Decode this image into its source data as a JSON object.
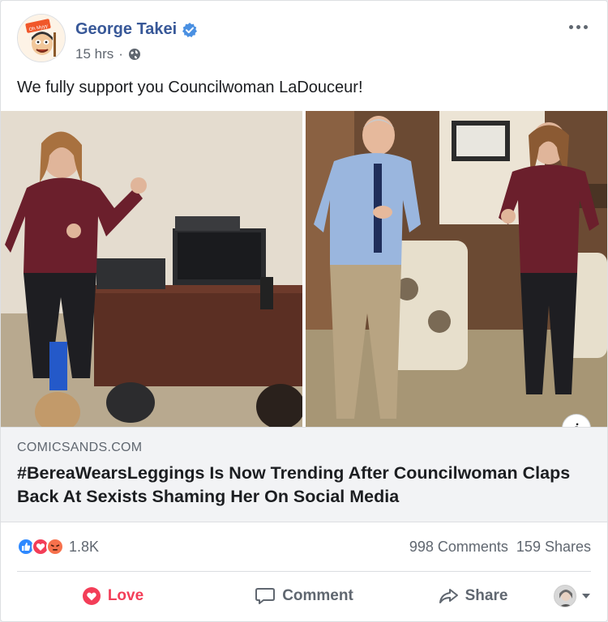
{
  "post": {
    "author": "George Takei",
    "time": "15 hrs",
    "separator": "·",
    "avatar_badge": "Oh Myyy",
    "text": "We fully support you Councilwoman LaDouceur!"
  },
  "link": {
    "domain": "COMICSANDS.COM",
    "headline": "#BereaWearsLeggings Is Now Trending After Councilwoman Claps Back At Sexists Shaming Her On Social Media",
    "info": "i"
  },
  "stats": {
    "reaction_count": "1.8K",
    "comments": "998 Comments",
    "shares": "159 Shares"
  },
  "actions": {
    "love": "Love",
    "comment": "Comment",
    "share": "Share"
  },
  "colors": {
    "brand_blue": "#385898",
    "love_red": "#f33e58",
    "muted": "#606770"
  }
}
